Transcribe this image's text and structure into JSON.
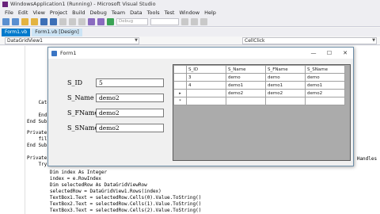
{
  "vs": {
    "title": "WindowsApplication1 (Running) - Microsoft Visual Studio",
    "menu": [
      "File",
      "Edit",
      "View",
      "Project",
      "Build",
      "Debug",
      "Team",
      "Data",
      "Tools",
      "Test",
      "Window",
      "Help"
    ],
    "config_combo": "Debug",
    "tabs": [
      "Form1.vb",
      "Form1.vb [Design]"
    ],
    "nav_left": "DataGridView1",
    "nav_right": "CellClick"
  },
  "code_lines": [
    {
      "text": "    Catch"
    },
    {
      "text": "        M"
    },
    {
      "text": "    End T"
    },
    {
      "text": "End Sub"
    },
    {
      "text": "Private S"
    },
    {
      "text": "    fill("
    },
    {
      "text": "End Sub"
    },
    {
      "text": "Private S"
    },
    {
      "text": "    Try"
    },
    {
      "text": "        Dim index As Integer"
    },
    {
      "text": "        index = e.RowIndex"
    },
    {
      "text": "        Dim selectedRow As DataGridViewRow"
    },
    {
      "text": "        selectedRow = DataGridView1.Rows(index)"
    },
    {
      "text": "        TextBox1.Text = selectedRow.Cells(0).Value.ToString()"
    },
    {
      "text": "        TextBox2.Text = selectedRow.Cells(1).Value.ToString()"
    },
    {
      "text": "        TextBox3.Text = selectedRow.Cells(2).Value.ToString()"
    }
  ],
  "code_right_fragment": "s) Handles",
  "form": {
    "title": "Form1",
    "fields": [
      {
        "label": "S_ID",
        "value": "5"
      },
      {
        "label": "S_Name",
        "value": "demo2"
      },
      {
        "label": "S_FName",
        "value": "demo2"
      },
      {
        "label": "S_SName",
        "value": "demo2"
      }
    ],
    "grid": {
      "columns": [
        "S_ID",
        "S_Name",
        "S_FName",
        "S_SName"
      ],
      "rows": [
        [
          "3",
          "demo",
          "demo",
          "demo"
        ],
        [
          "4",
          "demo1",
          "demo1",
          "demo1"
        ],
        [
          "5",
          "demo2",
          "demo2",
          "demo2"
        ],
        [
          "",
          "",
          "",
          ""
        ]
      ],
      "current_row_marker": "▸",
      "new_row_marker": "*",
      "selected_row_index": 2,
      "selected_cell_color": "#0078d7"
    }
  },
  "colors": {
    "accent": "#007acc",
    "keyword": "#0000ff",
    "type": "#2b91af"
  }
}
